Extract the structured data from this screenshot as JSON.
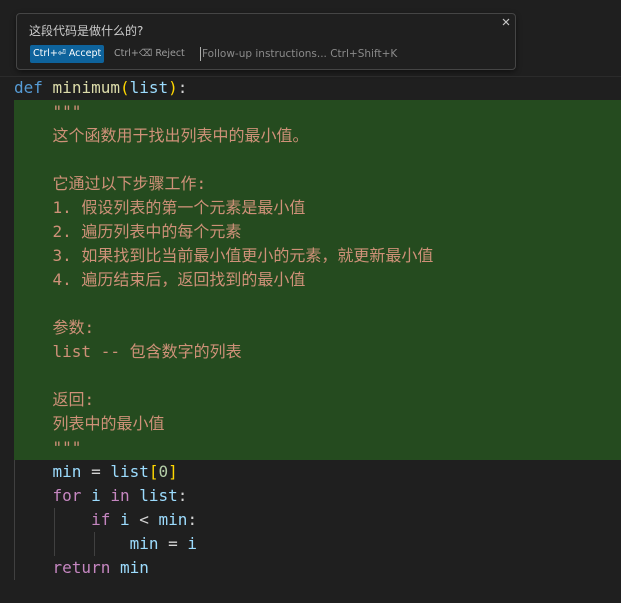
{
  "inline_chat": {
    "question": "这段代码是做什么的?",
    "accept_label": "Ctrl+⏎ Accept",
    "reject_label": "Ctrl+⌫ Reject",
    "followup_placeholder": "Follow-up instructions... Ctrl+Shift+K",
    "close_icon": "close-icon"
  },
  "code": {
    "def_kw": "def",
    "func_name": "minimum",
    "param": "list",
    "docstring_quotes": "\"\"\"",
    "doc_lines": [
      "这个函数用于找出列表中的最小值。",
      "",
      "它通过以下步骤工作:",
      "1. 假设列表的第一个元素是最小值",
      "2. 遍历列表中的每个元素",
      "3. 如果找到比当前最小值更小的元素，就更新最小值",
      "4. 遍历结束后，返回找到的最小值",
      "",
      "参数:",
      "list -- 包含数字的列表",
      "",
      "返回:",
      "列表中的最小值"
    ],
    "var_min": "min",
    "var_list": "list",
    "index_zero": "0",
    "for_kw": "for",
    "loop_var": "i",
    "in_kw": "in",
    "if_kw": "if",
    "lt_op": "<",
    "return_kw": "return"
  },
  "colors": {
    "editor_background": "#1f1f1f",
    "inserted_code_background": "#254b1f",
    "accept_button": "#0e639c",
    "keyword_blue": "#569cd6",
    "keyword_purple": "#c586c0",
    "function_yellow": "#dcdcaa",
    "variable_blue": "#9cdcfe",
    "string_orange": "#ce9178",
    "number_green": "#b5cea8",
    "bracket_gold": "#ffd700"
  }
}
